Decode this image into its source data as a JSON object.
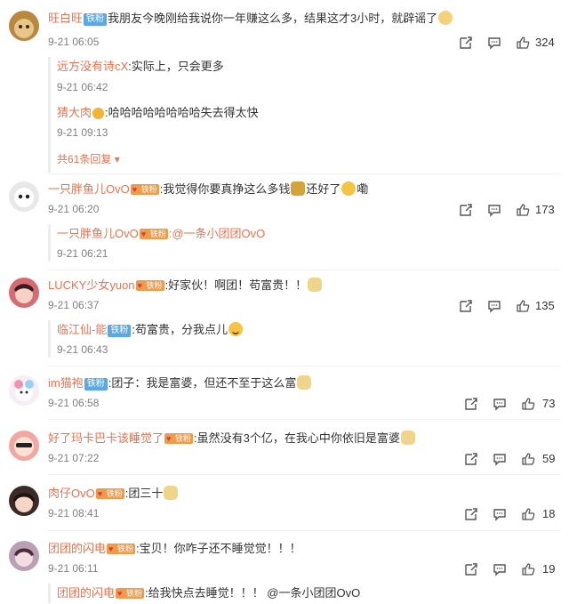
{
  "comments": [
    {
      "user": "旺白旺",
      "badge": "铁粉",
      "text": "我朋友今晚刚给我说你一年赚这么多，结果这才3小时，就辟谣了",
      "time": "9-21 06:05",
      "likes": "324",
      "replies": [
        {
          "user": "远方没有诗cX",
          "text": ":实际上，只会更多",
          "time": "9-21 06:42"
        },
        {
          "user": "猜大肉",
          "text": ":哈哈哈哈哈哈哈哈失去得太快",
          "time": "9-21 09:13"
        }
      ],
      "more": "共61条回复"
    },
    {
      "user": "一只胖鱼儿OvO",
      "badge": "铁粉",
      "text": ":我觉得你要真挣这么多钱",
      "text2": "还好了",
      "text3": "嘞",
      "time": "9-21 06:20",
      "likes": "173",
      "replies": [
        {
          "user": "一只胖鱼儿OvO",
          "badge": "铁粉",
          "text": ":@一条小团团OvO",
          "time": "9-21 06:21"
        }
      ]
    },
    {
      "user": "LUCKY少女yuon",
      "badge": "铁粉",
      "text": ":好家伙！啊团！苟富贵！！",
      "time": "9-21 06:37",
      "likes": "135",
      "replies": [
        {
          "user": "临江仙-能",
          "badge": "铁粉",
          "text": ":苟富贵，分我点儿",
          "time": "9-21 06:43"
        }
      ]
    },
    {
      "user": "im猫袍",
      "badge": "铁粉",
      "text": ":团子：我是富婆，但还不至于这么富",
      "time": "9-21 06:58",
      "likes": "73"
    },
    {
      "user": "好了玛卡巴卡该睡觉了",
      "badge": "铁粉",
      "text": ":虽然没有3个亿，在我心中你依旧是富婆",
      "time": "9-21 07:22",
      "likes": "59"
    },
    {
      "user": "肉仔OvO",
      "badge": "铁粉",
      "text": ":团三十",
      "time": "9-21 08:41",
      "likes": "18"
    },
    {
      "user": "团团的闪电",
      "badge": "铁粉",
      "text": ":宝贝！你咋子还不睡觉觉！！！",
      "time": "9-21 06:11",
      "likes": "19",
      "replies": [
        {
          "user": "团团的闪电",
          "badge": "铁粉",
          "text": ":给我快点去睡觉！！！ @一条小团团OvO"
        }
      ]
    }
  ],
  "colors": {
    "accent": "#eb7350",
    "iron_badge": "#5aa8e6",
    "fan_badge": "#f09b4a",
    "time": "#808080"
  },
  "icons": [
    "share-icon",
    "comment-icon",
    "like-icon"
  ]
}
